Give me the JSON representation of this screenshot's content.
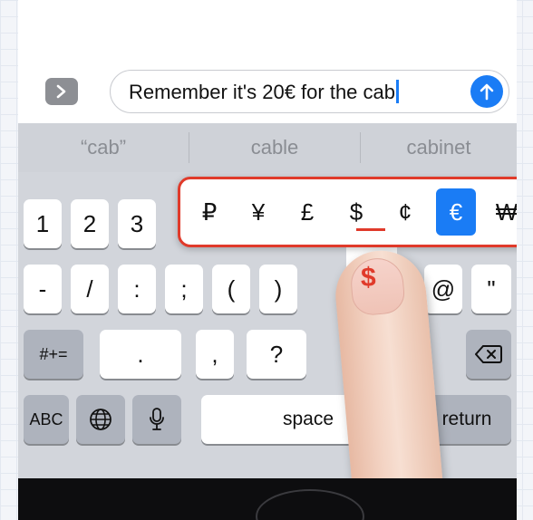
{
  "message_bar": {
    "expand_icon": "chevron-right-icon",
    "text": "Remember it's 20€ for the cab",
    "send_icon": "arrow-up-icon"
  },
  "predictive": [
    "“cab”",
    "cable",
    "cabinet"
  ],
  "currency_popup": {
    "symbols": [
      "₽",
      "¥",
      "£",
      "$",
      "¢",
      "€",
      "₩"
    ],
    "selected": "€",
    "highlighted": "$"
  },
  "keys": {
    "row1": [
      "1",
      "2",
      "3"
    ],
    "row2": [
      "-",
      "/",
      ":",
      ";",
      "(",
      ")",
      "&",
      "@",
      "\""
    ],
    "row3_left": "#+=",
    "row3": [
      ".",
      ",",
      "?"
    ],
    "row4": {
      "abc": "ABC",
      "space": "space",
      "return": "return"
    }
  },
  "finger_symbol": "$",
  "colors": {
    "accent": "#1a7cf5",
    "highlight": "#e03a2a"
  }
}
